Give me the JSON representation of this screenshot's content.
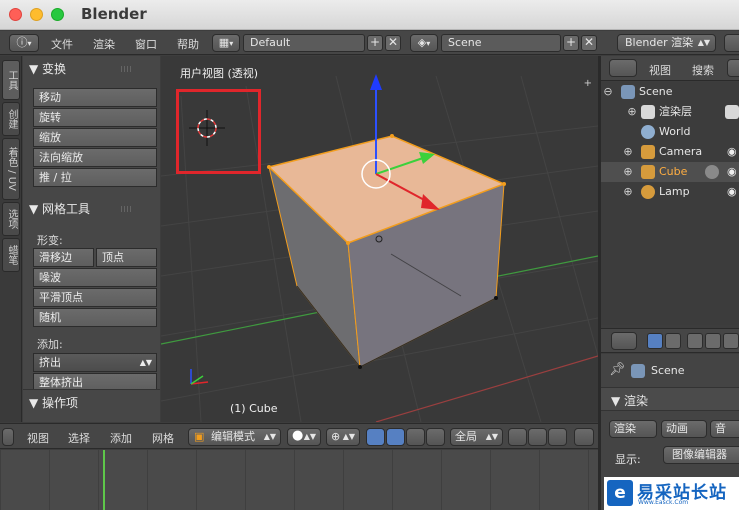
{
  "app": {
    "title": "Blender"
  },
  "topbar": {
    "menus": [
      "文件",
      "渲染",
      "窗口",
      "帮助"
    ],
    "screen_layout": "Default",
    "scene": "Scene",
    "render_engine": "Blender 渲染"
  },
  "tabs": [
    "工具",
    "创建",
    "着色 / UV",
    "选项",
    "蜡笔"
  ],
  "toolshelf": {
    "transform_header": "▼ 变换",
    "transform_buttons": [
      "移动",
      "旋转",
      "缩放",
      "法向缩放",
      "推 / 拉"
    ],
    "mesh_header": "▼ 网格工具",
    "deform_label": "形变:",
    "deform_buttons": [
      "滑移边",
      "顶点",
      "噪波",
      "平滑顶点",
      "随机"
    ],
    "add_label": "添加:",
    "extrude_select": "挤出",
    "extrude_all": "整体挤出",
    "operator_header": "▼ 操作项"
  },
  "viewport": {
    "view_title": "用户视图 (透视)",
    "object_label": "(1) Cube"
  },
  "bottombar": {
    "menus": [
      "视图",
      "选择",
      "添加",
      "网格"
    ],
    "mode": "编辑模式",
    "orientation": "全局"
  },
  "outliner": {
    "menus": [
      "视图",
      "搜索"
    ],
    "items": [
      "Scene",
      "渲染层",
      "World",
      "Camera",
      "Cube",
      "Lamp"
    ]
  },
  "properties": {
    "scene_label": "Scene",
    "render_header": "▼ 渲染",
    "render_tab": "渲染",
    "animation_tab": "动画",
    "audio_tab": "音",
    "display_label": "显示:",
    "display_value": "图像编辑器"
  },
  "watermark": {
    "text": "易采站长站",
    "sub": "Www.Easck.Com"
  },
  "colors": {
    "accent_selection": "#f29d1d",
    "cube_top": "#e8b897",
    "red_highlight": "#e0262b",
    "timeline_playhead": "#5ec84a"
  },
  "icons": [
    "info-icon",
    "screen-layout-icon",
    "scene-icon",
    "cursor-3d-icon",
    "cube-icon",
    "camera-icon",
    "lamp-icon",
    "world-icon",
    "eye-icon",
    "pin-icon",
    "render-icon"
  ]
}
